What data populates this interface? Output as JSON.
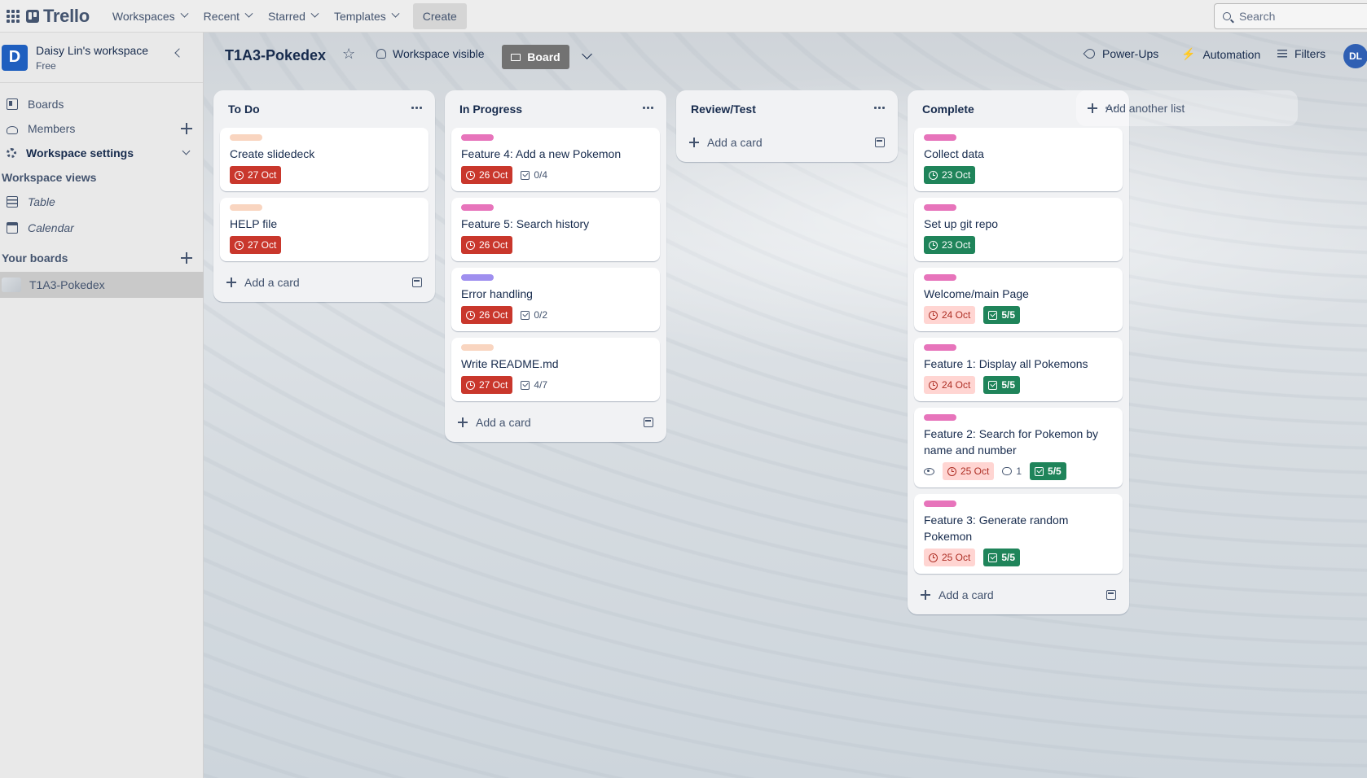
{
  "topnav": {
    "logo": "Trello",
    "menus": [
      "Workspaces",
      "Recent",
      "Starred",
      "Templates"
    ],
    "create": "Create",
    "search_placeholder": "Search"
  },
  "sidebar": {
    "workspace_initial": "D",
    "workspace_name": "Daisy Lin's workspace",
    "workspace_plan": "Free",
    "items": [
      {
        "label": "Boards",
        "icon": "boards-icon"
      },
      {
        "label": "Members",
        "icon": "member-icon"
      },
      {
        "label": "Workspace settings",
        "icon": "gear-icon"
      }
    ],
    "views_heading": "Workspace views",
    "views": [
      {
        "label": "Table",
        "icon": "table-icon"
      },
      {
        "label": "Calendar",
        "icon": "calendar-icon"
      }
    ],
    "boards_heading": "Your boards",
    "boards": [
      "T1A3-Pokedex"
    ]
  },
  "board": {
    "title": "T1A3-Pokedex",
    "visibility": "Workspace visible",
    "view": "Board",
    "actions": [
      "Power-Ups",
      "Automation",
      "Filters"
    ],
    "member_initials": "DL",
    "add_list": "Add another list",
    "add_card": "Add a card"
  },
  "colors": {
    "label_peach": "#f9d5c0",
    "label_pink": "#e774bb",
    "label_purple": "#9f8fef",
    "overdue": "#c9372c",
    "complete": "#1f845a",
    "late_bg": "#ffd5d2"
  },
  "lists": [
    {
      "title": "To Do",
      "cards": [
        {
          "label": "label_peach",
          "title": "Create slidedeck",
          "due": "27 Oct",
          "due_state": "overdue"
        },
        {
          "label": "label_peach",
          "title": "HELP file",
          "due": "27 Oct",
          "due_state": "overdue"
        }
      ]
    },
    {
      "title": "In Progress",
      "cards": [
        {
          "label": "label_pink",
          "title": "Feature 4: Add a new Pokemon",
          "due": "26 Oct",
          "due_state": "overdue",
          "checklist": "0/4"
        },
        {
          "label": "label_pink",
          "title": "Feature 5: Search history",
          "due": "26 Oct",
          "due_state": "overdue"
        },
        {
          "label": "label_purple",
          "title": "Error handling",
          "due": "26 Oct",
          "due_state": "overdue",
          "checklist": "0/2"
        },
        {
          "label": "label_peach",
          "title": "Write README.md",
          "due": "27 Oct",
          "due_state": "overdue",
          "checklist": "4/7"
        }
      ]
    },
    {
      "title": "Review/Test",
      "cards": []
    },
    {
      "title": "Complete",
      "cards": [
        {
          "label": "label_pink",
          "title": "Collect data",
          "due": "23 Oct",
          "due_state": "complete"
        },
        {
          "label": "label_pink",
          "title": "Set up git repo",
          "due": "23 Oct",
          "due_state": "complete"
        },
        {
          "label": "label_pink",
          "title": "Welcome/main Page",
          "due": "24 Oct",
          "due_state": "late",
          "checklist": "5/5",
          "checklist_done": true
        },
        {
          "label": "label_pink",
          "title": "Feature 1: Display all Pokemons",
          "due": "24 Oct",
          "due_state": "late",
          "checklist": "5/5",
          "checklist_done": true
        },
        {
          "label": "label_pink",
          "title": "Feature 2: Search for Pokemon by name and number",
          "watching": true,
          "due": "25 Oct",
          "due_state": "late",
          "comments": "1",
          "checklist": "5/5",
          "checklist_done": true
        },
        {
          "label": "label_pink",
          "title": "Feature 3: Generate random Pokemon",
          "due": "25 Oct",
          "due_state": "late",
          "checklist": "5/5",
          "checklist_done": true
        }
      ]
    }
  ]
}
